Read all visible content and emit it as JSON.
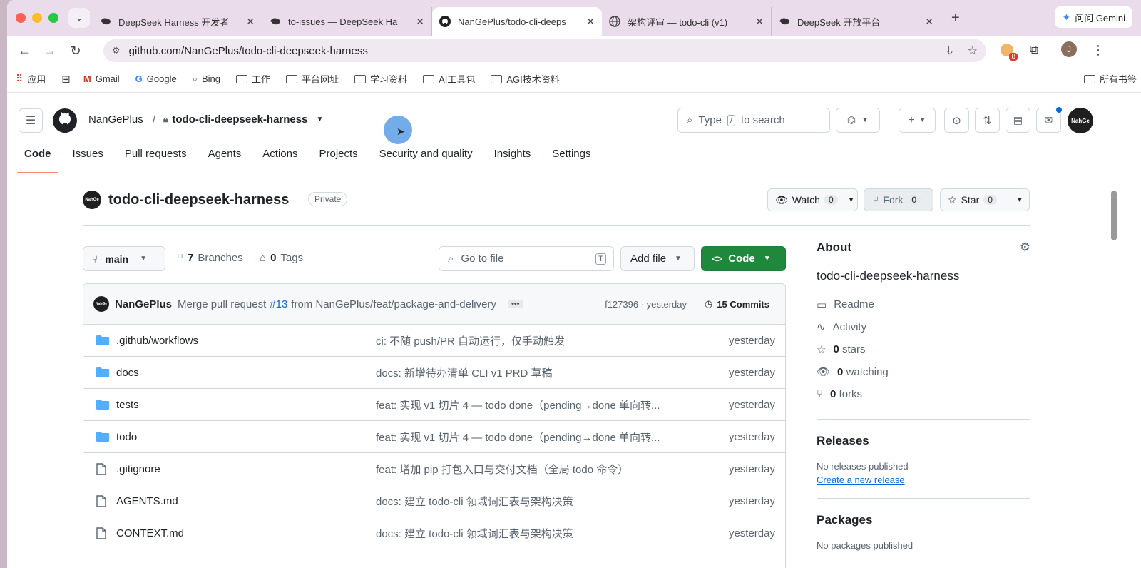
{
  "browser": {
    "tabs": [
      {
        "title": "DeepSeek Harness 开发者",
        "icon": "deepseek-whale-icon"
      },
      {
        "title": "to-issues — DeepSeek Ha",
        "icon": "deepseek-whale-icon"
      },
      {
        "title": "NanGePlus/todo-cli-deeps",
        "icon": "github-icon"
      },
      {
        "title": "架构评审 — todo-cli (v1)",
        "icon": "globe-icon"
      },
      {
        "title": "DeepSeek 开放平台",
        "icon": "deepseek-whale-icon"
      }
    ],
    "gemini_label": "问问 Gemini",
    "url": "github.com/NanGePlus/todo-cli-deepseek-harness",
    "extension_badge": "8",
    "profile_initial": "J",
    "bookmarks": [
      "应用",
      "Gmail",
      "Google",
      "Bing",
      "工作",
      "平台网址",
      "学习资料",
      "AI工具包",
      "AGI技术资料"
    ],
    "all_bookmarks": "所有书签"
  },
  "header": {
    "owner": "NanGePlus",
    "separator": "/",
    "repo": "todo-cli-deepseek-harness",
    "search_prefix": "Type",
    "search_key": "/",
    "search_suffix": "to search",
    "avatar_text": "NahGe",
    "nav": [
      "Code",
      "Issues",
      "Pull requests",
      "Agents",
      "Actions",
      "Projects",
      "Security and quality",
      "Insights",
      "Settings"
    ]
  },
  "repo": {
    "name": "todo-cli-deepseek-harness",
    "visibility": "Private",
    "avatar_text": "NahGe",
    "watch_label": "Watch",
    "watch_count": "0",
    "fork_label": "Fork",
    "fork_count": "0",
    "star_label": "Star",
    "star_count": "0"
  },
  "toolbar": {
    "branch": "main",
    "branches_count": "7",
    "branches_label": "Branches",
    "tags_count": "0",
    "tags_label": "Tags",
    "goto_placeholder": "Go to file",
    "goto_key": "T",
    "add_file": "Add file",
    "code": "Code"
  },
  "commit": {
    "author": "NanGePlus",
    "message_prefix": "Merge pull request",
    "pr": "#13",
    "message_suffix": "from NanGePlus/feat/package-and-delivery",
    "hash_time": "f127396 · yesterday",
    "commits": "15 Commits"
  },
  "files": [
    {
      "name": ".github/workflows",
      "type": "dir",
      "message": "ci: 不随 push/PR 自动运行，仅手动触发",
      "date": "yesterday"
    },
    {
      "name": "docs",
      "type": "dir",
      "message": "docs: 新增待办清单 CLI v1 PRD 草稿",
      "date": "yesterday"
    },
    {
      "name": "tests",
      "type": "dir",
      "message": "feat: 实现 v1 切片 4 — todo done（pending→done 单向转...",
      "date": "yesterday"
    },
    {
      "name": "todo",
      "type": "dir",
      "message": "feat: 实现 v1 切片 4 — todo done（pending→done 单向转...",
      "date": "yesterday"
    },
    {
      "name": ".gitignore",
      "type": "file",
      "message": "feat: 增加 pip 打包入口与交付文档（全局 todo 命令）",
      "date": "yesterday"
    },
    {
      "name": "AGENTS.md",
      "type": "file",
      "message": "docs: 建立 todo-cli 领域词汇表与架构决策",
      "date": "yesterday"
    },
    {
      "name": "CONTEXT.md",
      "type": "file",
      "message": "docs: 建立 todo-cli 领域词汇表与架构决策",
      "date": "yesterday"
    }
  ],
  "about": {
    "title": "About",
    "description": "todo-cli-deepseek-harness",
    "readme": "Readme",
    "activity": "Activity",
    "stars_count": "0",
    "stars_label": "stars",
    "watching_count": "0",
    "watching_label": "watching",
    "forks_count": "0",
    "forks_label": "forks",
    "releases_title": "Releases",
    "releases_empty": "No releases published",
    "create_release": "Create a new release",
    "packages_title": "Packages",
    "packages_empty": "No packages published"
  },
  "colors": {
    "accent_green": "#1f883d",
    "link_blue": "#0969da",
    "folder_blue": "#54aeff",
    "tab_bg": "#eadcea"
  }
}
